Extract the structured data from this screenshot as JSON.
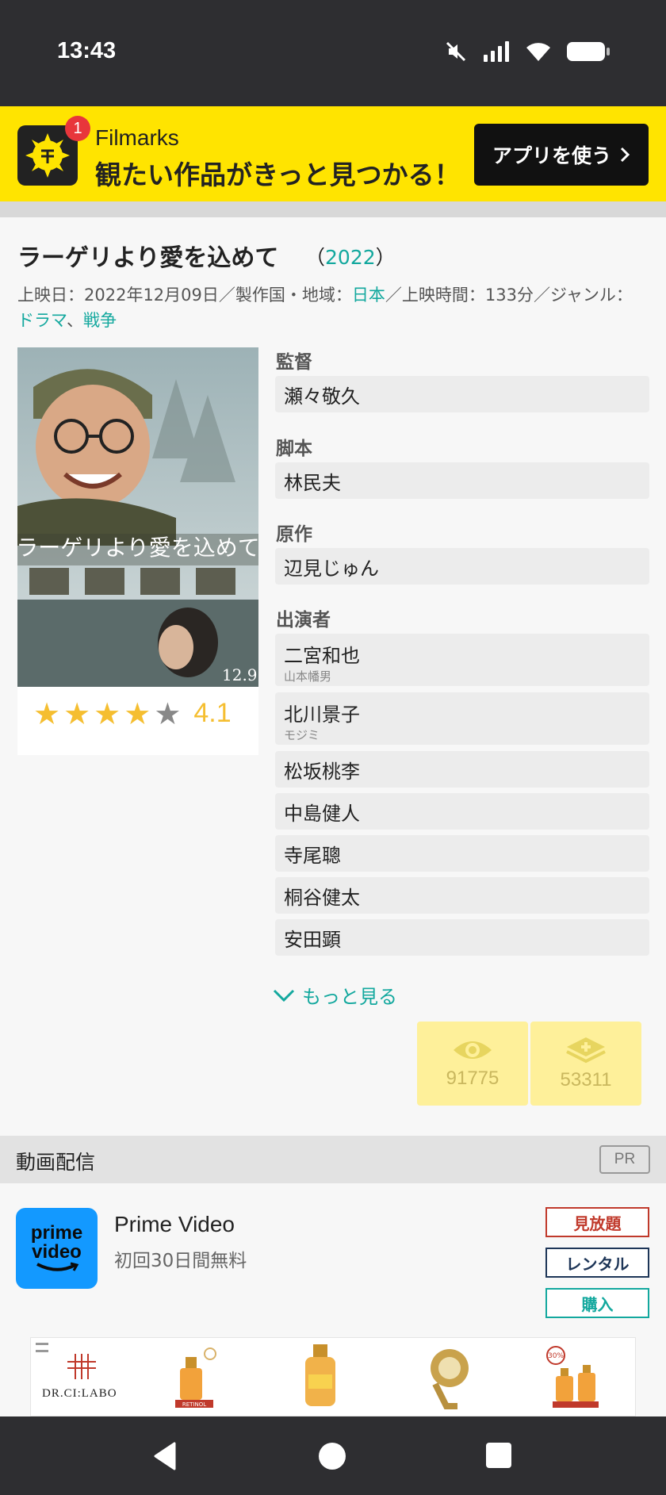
{
  "status_bar": {
    "time": "13:43"
  },
  "app_banner": {
    "badge_count": "1",
    "app_name": "Filmarks",
    "tagline": "観たい作品がきっと見つかる！",
    "button_label": "アプリを使う",
    "accent": "#ffe400"
  },
  "movie": {
    "title": "ラーゲリより愛を込めて",
    "year_open": "（",
    "year": "2022",
    "year_close": "）",
    "meta": {
      "release_label": "上映日：",
      "release_date": "2022年12月09日",
      "country_label": "／製作国・地域：",
      "country": "日本",
      "runtime_label": "／上映時間：",
      "runtime": "133分",
      "genre_label": "／ジャンル：",
      "genre1": "ドラマ",
      "genre_sep": "、",
      "genre2": "戦争"
    },
    "rating": {
      "score": "4.1",
      "stars_filled": 4,
      "stars_total": 5
    }
  },
  "credits": {
    "director_label": "監督",
    "director": "瀬々敬久",
    "writer_label": "脚本",
    "writer": "林民夫",
    "original_label": "原作",
    "original": "辺見じゅん",
    "cast_label": "出演者",
    "cast": [
      {
        "name": "二宮和也",
        "role": "山本幡男"
      },
      {
        "name": "北川景子",
        "role": "モジミ"
      },
      {
        "name": "松坂桃李"
      },
      {
        "name": "中島健人"
      },
      {
        "name": "寺尾聰"
      },
      {
        "name": "桐谷健太"
      },
      {
        "name": "安田顕"
      }
    ],
    "more_label": "もっと見る"
  },
  "counts": {
    "watched": "91775",
    "clipped": "53311"
  },
  "video_section": {
    "title": "動画配信",
    "pr_badge": "PR",
    "service": {
      "logo_line1": "prime",
      "logo_line2": "video",
      "name": "Prime Video",
      "offer": "初回30日間無料",
      "options": [
        "見放題",
        "レンタル",
        "購入"
      ]
    }
  },
  "ad": {
    "brand": "DR.CI:LABO",
    "label1": "RETINOL",
    "badge": "30%"
  },
  "colors": {
    "teal": "#13a89e",
    "star": "#f5be30",
    "count_bg": "#fef09a"
  }
}
